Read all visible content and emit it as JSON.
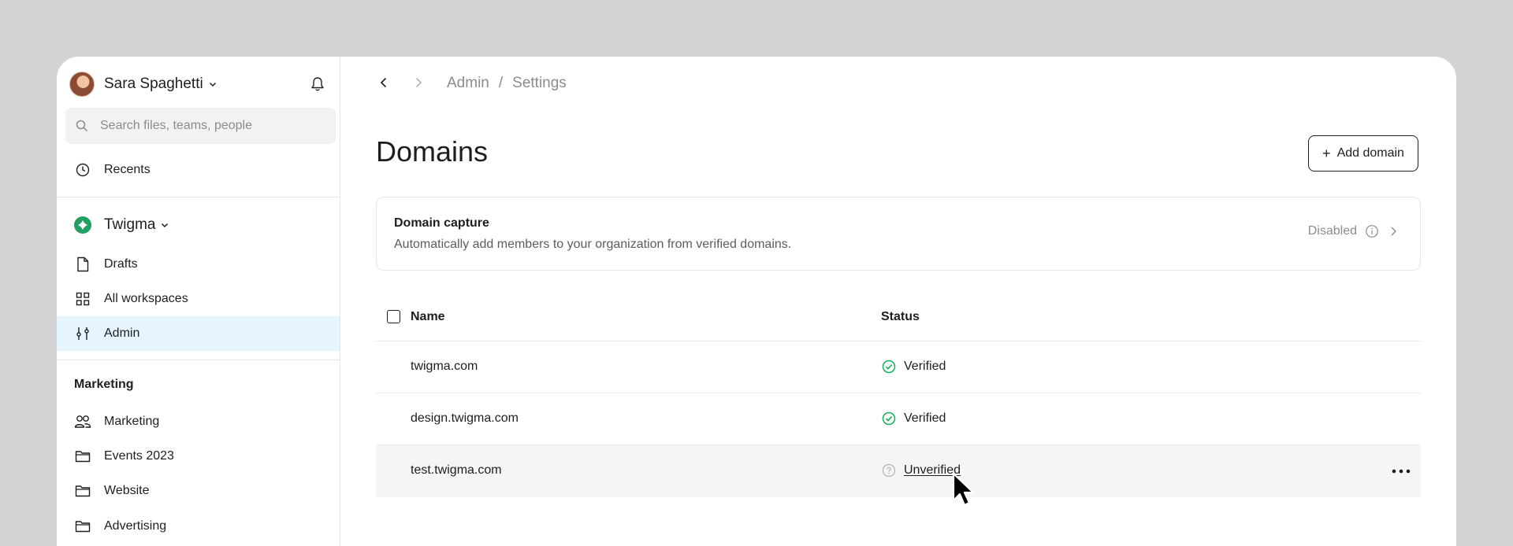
{
  "sidebar": {
    "user_name": "Sara Spaghetti",
    "search_placeholder": "Search files, teams, people",
    "recents_label": "Recents",
    "team_name": "Twigma",
    "team_items": [
      {
        "label": "Drafts",
        "icon": "file-icon"
      },
      {
        "label": "All workspaces",
        "icon": "grid-icon"
      },
      {
        "label": "Admin",
        "icon": "sliders-icon",
        "active": true
      }
    ],
    "section_title": "Marketing",
    "section_items": [
      {
        "label": "Marketing",
        "icon": "people-icon"
      },
      {
        "label": "Events 2023",
        "icon": "folder-icon"
      },
      {
        "label": "Website",
        "icon": "folder-icon"
      },
      {
        "label": "Advertising",
        "icon": "folder-icon"
      }
    ]
  },
  "header": {
    "breadcrumb": [
      "Admin",
      "/",
      "Settings"
    ]
  },
  "main": {
    "title": "Domains",
    "add_button_label": "Add domain",
    "capture": {
      "title": "Domain capture",
      "description": "Automatically add members to your organization from verified domains.",
      "status": "Disabled"
    },
    "table": {
      "columns": [
        "Name",
        "Status"
      ],
      "rows": [
        {
          "name": "twigma.com",
          "status": "Verified"
        },
        {
          "name": "design.twigma.com",
          "status": "Verified"
        },
        {
          "name": "test.twigma.com",
          "status": "Unverified"
        }
      ]
    }
  },
  "colors": {
    "accent_active_bg": "#e5f4ff",
    "verified_green": "#14ae5c",
    "team_green": "#22a064"
  }
}
